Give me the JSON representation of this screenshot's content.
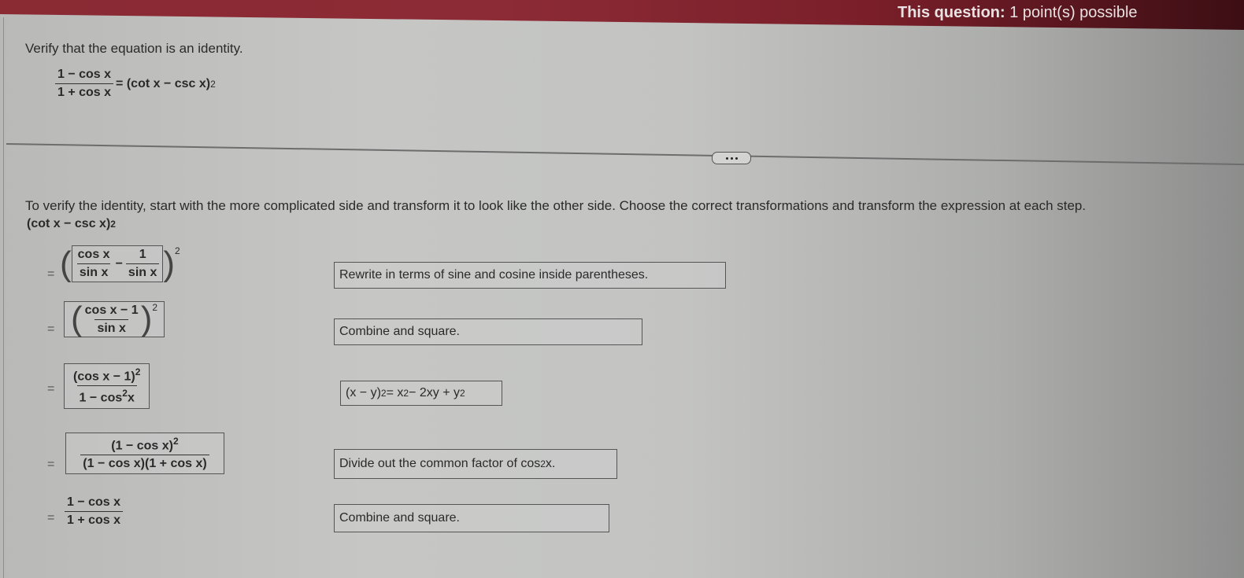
{
  "header": {
    "label_bold": "This question:",
    "label_rest": " 1 point(s) possible"
  },
  "question": {
    "prompt": "Verify that the equation is an identity.",
    "lhs_num": "1 − cos x",
    "lhs_den": "1 + cos x",
    "rhs": "= (cot x − csc x)",
    "rhs_exp": "2"
  },
  "more_button": {
    "icon": "ellipsis-icon"
  },
  "instructions": "To verify the identity, start with the more complicated side and transform it to look like the other side. Choose the correct transformations and transform the expression at each step.",
  "start_expr": {
    "text": "(cot x − csc x)",
    "exp": "2"
  },
  "steps": [
    {
      "eq": "=",
      "expr": {
        "f1_num": "cos x",
        "f1_den": "sin x",
        "op": "−",
        "f2_num": "1",
        "f2_den": "sin x",
        "exp": "2"
      },
      "reason": "Rewrite in terms of sine and cosine inside parentheses."
    },
    {
      "eq": "=",
      "expr": {
        "num": "cos x − 1",
        "den": "sin x",
        "exp": "2"
      },
      "reason": "Combine and square."
    },
    {
      "eq": "=",
      "expr": {
        "num": "(cos x − 1)",
        "num_exp": "2",
        "den_a": "1 − cos",
        "den_exp": "2",
        "den_b": "x"
      },
      "reason": {
        "a": "(x − y)",
        "a_exp": "2",
        "b": " = x",
        "b_exp": "2",
        "c": " − 2xy + y",
        "c_exp": "2"
      }
    },
    {
      "eq": "=",
      "expr": {
        "num": "(1 − cos x)",
        "num_exp": "2",
        "den": "(1 − cos x)(1 + cos x)"
      },
      "reason": {
        "text": "Divide out the common factor of cos",
        "exp": "2",
        "tail": "x."
      }
    },
    {
      "eq": "=",
      "expr": {
        "num": "1 − cos x",
        "den": "1 + cos x"
      },
      "reason": "Combine and square."
    }
  ]
}
